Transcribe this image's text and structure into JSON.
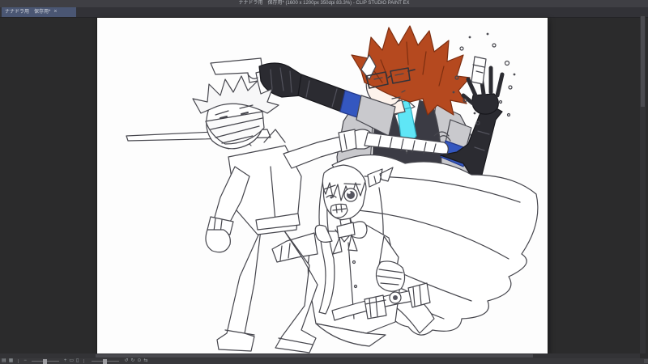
{
  "window": {
    "title": "ナナドラ用　保存用* (1600 x 1200px 350dpi 83.3%) - CLIP STUDIO PAINT EX",
    "app_name": "CLIP STUDIO PAINT EX"
  },
  "tab": {
    "label": "ナナドラ用　保存用*",
    "close": "×"
  },
  "canvas": {
    "zoom_percent": "83.3%"
  },
  "statusbar": {
    "icons": {
      "nav1": "▤",
      "nav2": "▦",
      "zoom_out": "−",
      "zoom_in": "+",
      "fit1": "▭",
      "fit2": "▯",
      "rotate_ccw": "↺",
      "rotate_cw": "↻",
      "reset": "⊙",
      "flip": "⇆"
    }
  },
  "colors": {
    "titlebar": "#3f3f44",
    "tabbar": "#323237",
    "tab": "#4a5673",
    "workspace": "#2b2b2c",
    "statusbar": "#38383b",
    "scroll_track": "#333336",
    "scroll_thumb": "#4a4a4f",
    "canvas": "#fdfdfd",
    "line": "#46464d",
    "hair_red": "#b5491f",
    "hair_red_dark": "#7d2e10",
    "tie_cyan": "#5fe6f6",
    "tie_cyan_dark": "#2fa9bd",
    "glove_black": "#2b2b31",
    "glove_edge": "#17171c",
    "glove_panel": "#52525c",
    "band_blue": "#3457c0",
    "band_blue_dark": "#24398a",
    "jacket_gray": "#c9c9cd",
    "vest_dark": "#3b3b44",
    "skin": "#fdf3ec"
  },
  "artwork": {
    "style": "anime line-art sketch, mostly uncolored with few color accents",
    "characters": [
      {
        "id": "masked-swordsman",
        "desc": "spiky light-haired fighter, striped mask over face, white coat, clenched fist, drawing a katana with wrapped handle"
      },
      {
        "id": "red-haired-gunman",
        "desc": "spiky red hair, glasses, grey jacket, dark vest, cyan tie, long black gloves, blue armbands, pistol aimed left, raised hand with falling vial and droplets"
      },
      {
        "id": "long-haired-girl",
        "desc": "long flowing hair sweeping right, shocked wide eye, gritted teeth, hair ribbon, neck bow, striped glove fist, belt with pouches"
      }
    ]
  }
}
